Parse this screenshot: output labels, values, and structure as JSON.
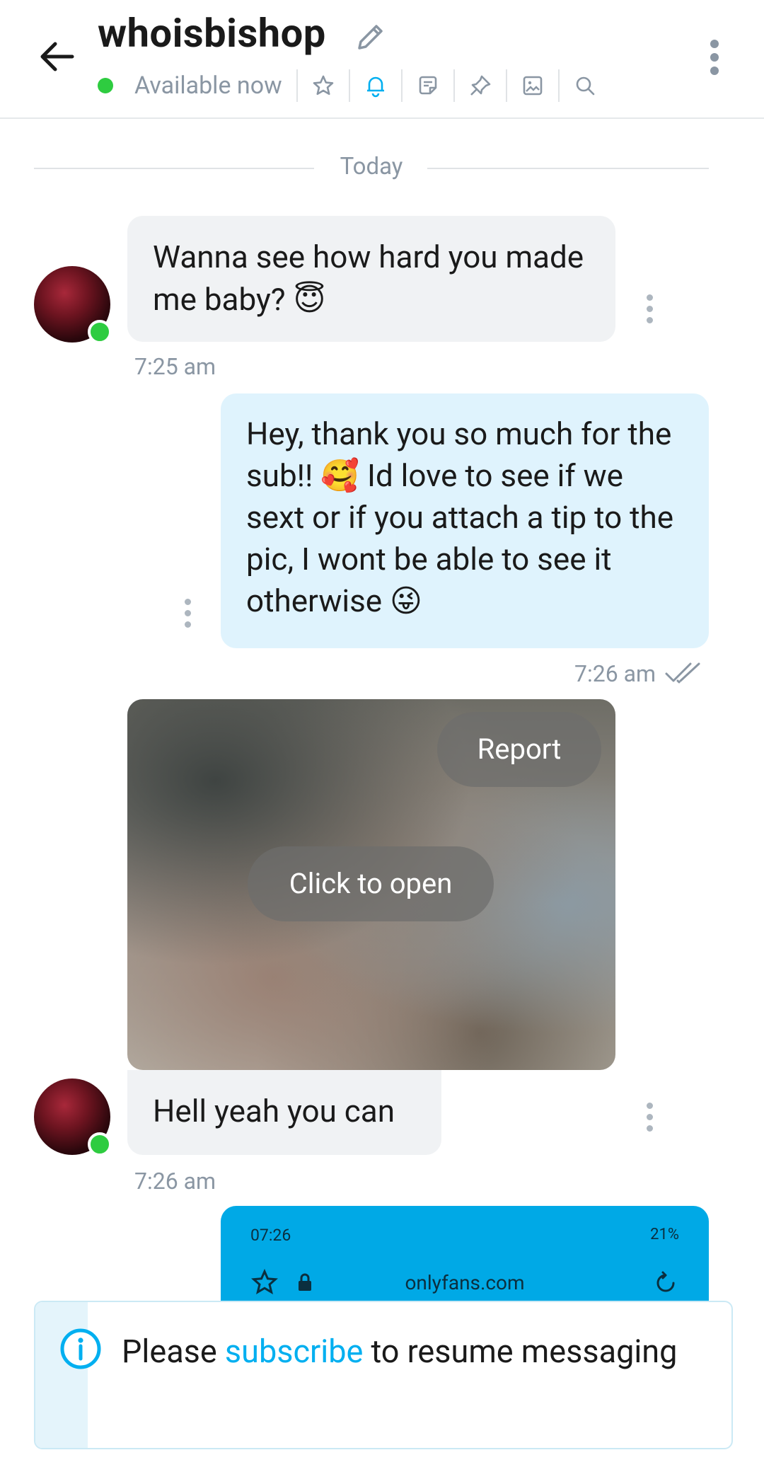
{
  "header": {
    "username": "whoisbishop",
    "status": "Available now",
    "tools": [
      "star-icon",
      "bell-icon",
      "note-icon",
      "pin-icon",
      "image-icon",
      "search-icon"
    ]
  },
  "divider": {
    "label": "Today"
  },
  "messages": [
    {
      "side": "in",
      "text": "Wanna see how hard you made me baby? 😇",
      "time": "7:25 am"
    },
    {
      "side": "out",
      "text": "Hey, thank you so much for the sub!! 🥰 Id love to see if we sext or if you attach a tip to the pic, I wont be able to see it otherwise 😜",
      "time": "7:26 am"
    },
    {
      "side": "in",
      "type": "media",
      "report_label": "Report",
      "open_label": "Click to open"
    },
    {
      "side": "in",
      "text": "Hell yeah you can",
      "time": "7:26 am"
    }
  ],
  "preview": {
    "status_time": "07:26",
    "battery": "21%",
    "url": "onlyfans.com"
  },
  "banner": {
    "before": "Please ",
    "link": "subscribe",
    "after": " to resume messaging"
  },
  "colors": {
    "accent": "#00aff0",
    "online": "#2ecc40",
    "incoming_bubble": "#f0f2f4",
    "outgoing_bubble": "#dff3fd"
  }
}
